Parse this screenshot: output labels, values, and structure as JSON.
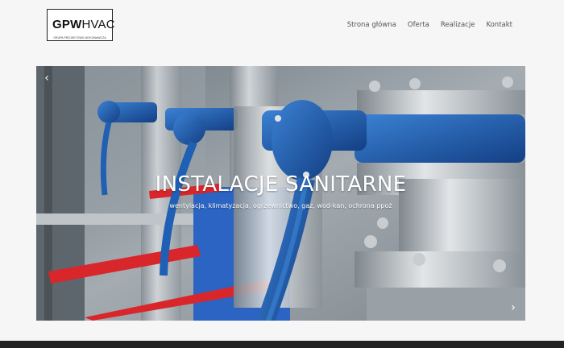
{
  "logo": {
    "bold": "GPW",
    "rest": "HVAC",
    "subtitle": "GRUPA PROJEKTOWO-WYKONAWCZA"
  },
  "nav": {
    "items": [
      "Strona główna",
      "Oferta",
      "Realizacje",
      "Kontakt"
    ]
  },
  "slider": {
    "title": "INSTALACJE SANITARNE",
    "subtitle": "wentylacja, klimatyzacja, ogrzewnictwo, gaz, wod-kan, ochrona ppoż",
    "prev_icon": "chevron-left-icon",
    "next_icon": "chevron-right-icon"
  },
  "colors": {
    "valve_blue": "#1f5fb4",
    "pipe_red": "#d8262b",
    "steel": "#b8bec4",
    "footer": "#222222"
  }
}
